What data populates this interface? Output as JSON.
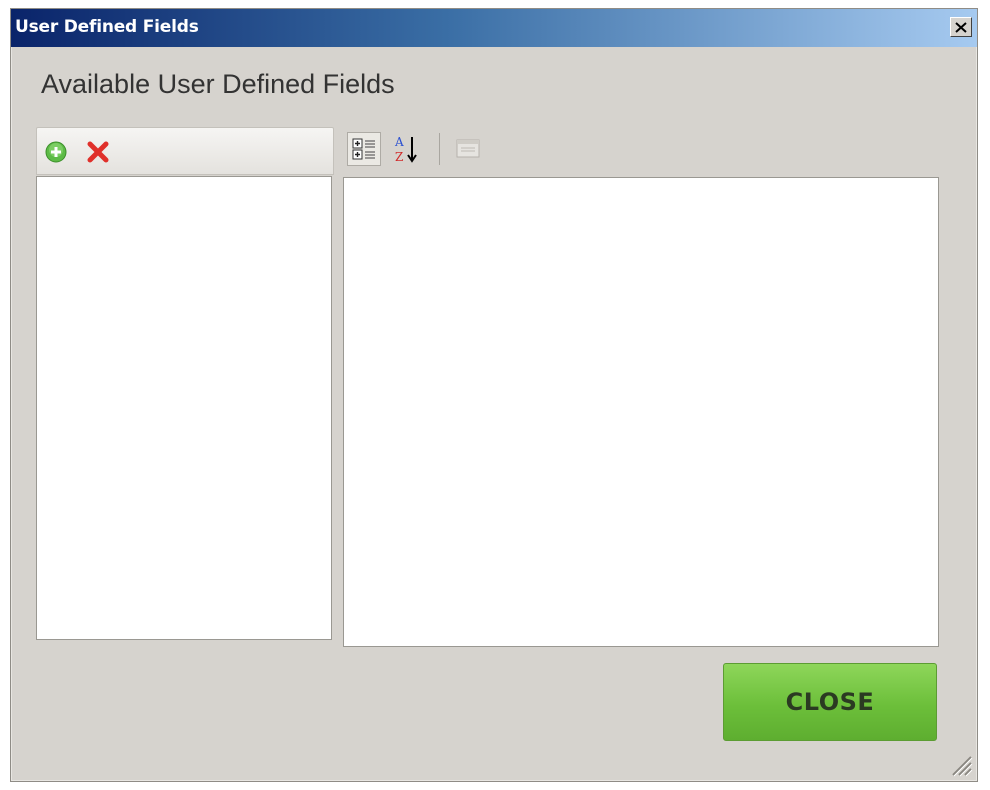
{
  "window": {
    "title": "User Defined Fields",
    "titlebar_gradient": [
      "#0a246a",
      "#3a6ea5",
      "#a6caf0"
    ]
  },
  "heading": "Available User Defined Fields",
  "left_toolbar": {
    "buttons": [
      {
        "icon": "add-icon",
        "color": "#4caf3a"
      },
      {
        "icon": "delete-icon",
        "color": "#e0302a"
      }
    ]
  },
  "right_toolbar": {
    "buttons": [
      {
        "icon": "categorized-view-icon",
        "active": true
      },
      {
        "icon": "sort-alphabetical-icon",
        "active": false
      },
      {
        "icon": "property-pages-icon",
        "active": false,
        "disabled": true
      }
    ]
  },
  "actions": {
    "close_label": "CLOSE",
    "close_color": "#6cbf3a"
  }
}
